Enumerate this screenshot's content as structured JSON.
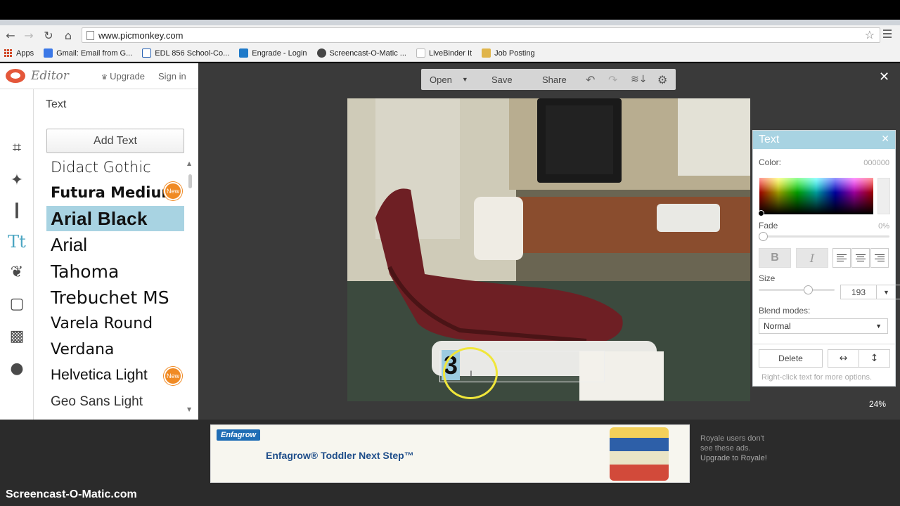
{
  "browser": {
    "url": "www.picmonkey.com",
    "bookmarks": [
      {
        "label": "Apps",
        "color": "#d04a2a"
      },
      {
        "label": "Gmail: Email from G...",
        "color": "#3b78e7"
      },
      {
        "label": "EDL 856 School-Co...",
        "color": "#2a63b3"
      },
      {
        "label": "Engrade - Login",
        "color": "#1f7ac9"
      },
      {
        "label": "Screencast-O-Matic ...",
        "color": "#444444"
      },
      {
        "label": "LiveBinder It",
        "color": "#bbbbbb"
      },
      {
        "label": "Job Posting",
        "color": "#e0b54a"
      }
    ]
  },
  "app": {
    "logo_text": "Editor",
    "upgrade_label": "Upgrade",
    "signin_label": "Sign in",
    "panel_title": "Text",
    "add_text_label": "Add Text",
    "tools": [
      {
        "name": "crop-icon",
        "glyph": "⌗"
      },
      {
        "name": "magic-wand-icon",
        "glyph": "✦"
      },
      {
        "name": "touchup-icon",
        "glyph": "❙"
      },
      {
        "name": "text-tool-icon",
        "glyph": "Tt"
      },
      {
        "name": "overlay-butterfly-icon",
        "glyph": "❦"
      },
      {
        "name": "frame-icon",
        "glyph": "▢"
      },
      {
        "name": "texture-icon",
        "glyph": "▩"
      },
      {
        "name": "theme-apple-icon",
        "glyph": "●"
      }
    ],
    "fonts": [
      {
        "label": "Didact Gothic",
        "new": false
      },
      {
        "label": "Futura Medium",
        "new": true
      },
      {
        "label": "Arial Black",
        "new": false,
        "selected": true
      },
      {
        "label": "Arial",
        "new": false
      },
      {
        "label": "Tahoma",
        "new": false
      },
      {
        "label": "Trebuchet MS",
        "new": false
      },
      {
        "label": "Varela Round",
        "new": false
      },
      {
        "label": "Verdana",
        "new": false
      },
      {
        "label": "Helvetica Light",
        "new": true
      },
      {
        "label": "Geo Sans Light",
        "new": false
      }
    ],
    "new_badge_label": "New",
    "toolbar": {
      "open_label": "Open",
      "save_label": "Save",
      "share_label": "Share"
    },
    "zoom_label": "24%",
    "text_content": "3"
  },
  "palette": {
    "title": "Text",
    "color_label": "Color:",
    "color_value": "000000",
    "fade_label": "Fade",
    "fade_value": "0%",
    "fade_level": 0,
    "bold_label": "B",
    "italic_label": "I",
    "size_label": "Size",
    "size_value": "193",
    "size_level": 0.65,
    "blend_label": "Blend modes:",
    "blend_value": "Normal",
    "delete_label": "Delete",
    "hint": "Right-click text for more options."
  },
  "ad": {
    "brand": "Enfagrow",
    "title": "Enfagrow® Toddler Next Step™",
    "royale_text": "Royale users don't see these ads.",
    "royale_link": "Upgrade to Royale!"
  },
  "watermark": "Screencast-O-Matic.com",
  "colors": {
    "accent": "#a8d3e2",
    "stage": "#3a3a3a",
    "new_badge": "#f08a24"
  }
}
